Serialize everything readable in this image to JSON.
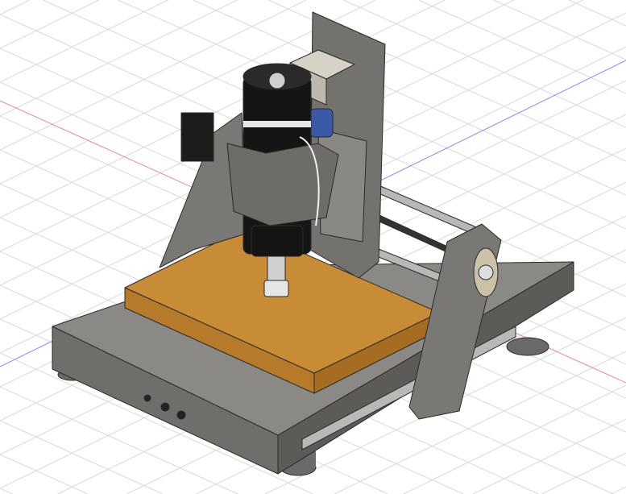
{
  "viewport": {
    "background": "#ffffff",
    "grid_color": "#d9d9d9",
    "x_axis_color": "#e07a7a",
    "y_axis_color": "#7a7ae0"
  },
  "model": {
    "base_color": "#6f6d69",
    "base_top_color": "#8a8884",
    "wood_top_color": "#c98c36",
    "wood_side_color": "#b67a2a",
    "gantry_color": "#7c7a76",
    "spindle_color": "#151515",
    "rail_color": "#b8b8b8"
  }
}
